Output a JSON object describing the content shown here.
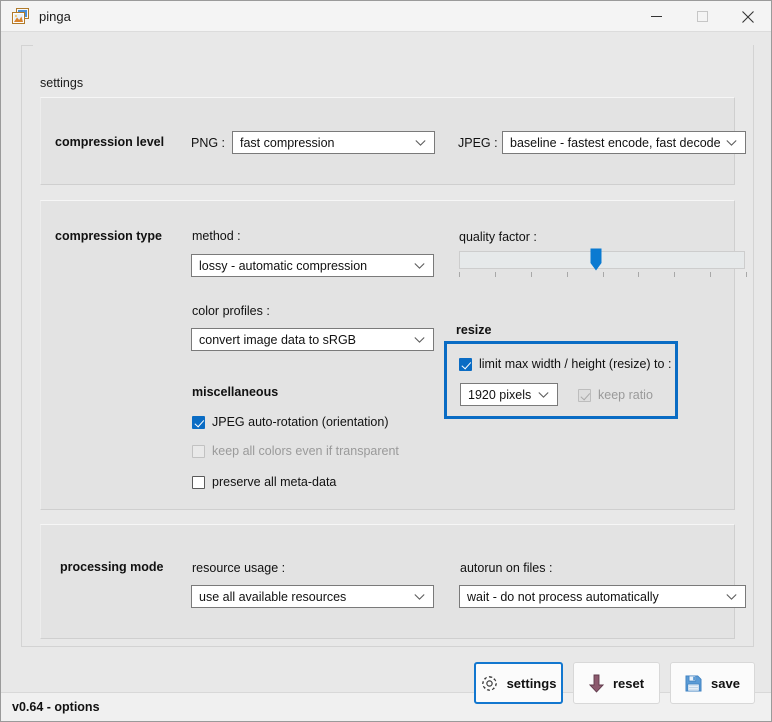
{
  "window": {
    "title": "pinga",
    "icon": "images-stack-icon",
    "controls": {
      "minimize": "minimize-icon",
      "maximize": "maximize-icon",
      "close": "close-icon"
    }
  },
  "settings_group": {
    "label": "settings"
  },
  "compression_level": {
    "title": "compression level",
    "png_label": "PNG :",
    "png_value": "fast compression",
    "jpeg_label": "JPEG :",
    "jpeg_value": "baseline - fastest encode, fast decode"
  },
  "compression_type": {
    "title": "compression type",
    "method_label": "method :",
    "method_value": "lossy - automatic compression",
    "color_profiles_label": "color profiles :",
    "color_profiles_value": "convert image data to sRGB",
    "quality_factor_label": "quality factor :",
    "quality_factor_ticks": 9,
    "quality_factor_position_percent": 48,
    "miscellaneous_label": "miscellaneous",
    "checkboxes": [
      {
        "label": "JPEG auto-rotation (orientation)",
        "checked": true,
        "enabled": true
      },
      {
        "label": "keep all colors even if transparent",
        "checked": false,
        "enabled": false
      },
      {
        "label": "preserve all meta-data",
        "checked": false,
        "enabled": true
      }
    ]
  },
  "resize": {
    "title": "resize",
    "limit_label": "limit max width / height (resize) to :",
    "limit_checked": true,
    "size_value": "1920 pixels",
    "keep_ratio_label": "keep ratio",
    "keep_ratio_checked": true,
    "keep_ratio_enabled": false
  },
  "processing_mode": {
    "title": "processing mode",
    "resource_label": "resource usage :",
    "resource_value": "use all available resources",
    "autorun_label": "autorun on files :",
    "autorun_value": "wait - do not process automatically"
  },
  "buttons": {
    "settings": {
      "label": "settings",
      "icon": "gear-icon"
    },
    "reset": {
      "label": "reset",
      "icon": "down-arrow-icon"
    },
    "save": {
      "label": "save",
      "icon": "floppy-disk-icon"
    }
  },
  "statusbar": {
    "text": "v0.64 - options"
  },
  "colors": {
    "accent": "#0a6cc4",
    "focus": "#1277cf",
    "reset_icon": "#8d5a6e",
    "save_icon": "#4a90d9"
  }
}
